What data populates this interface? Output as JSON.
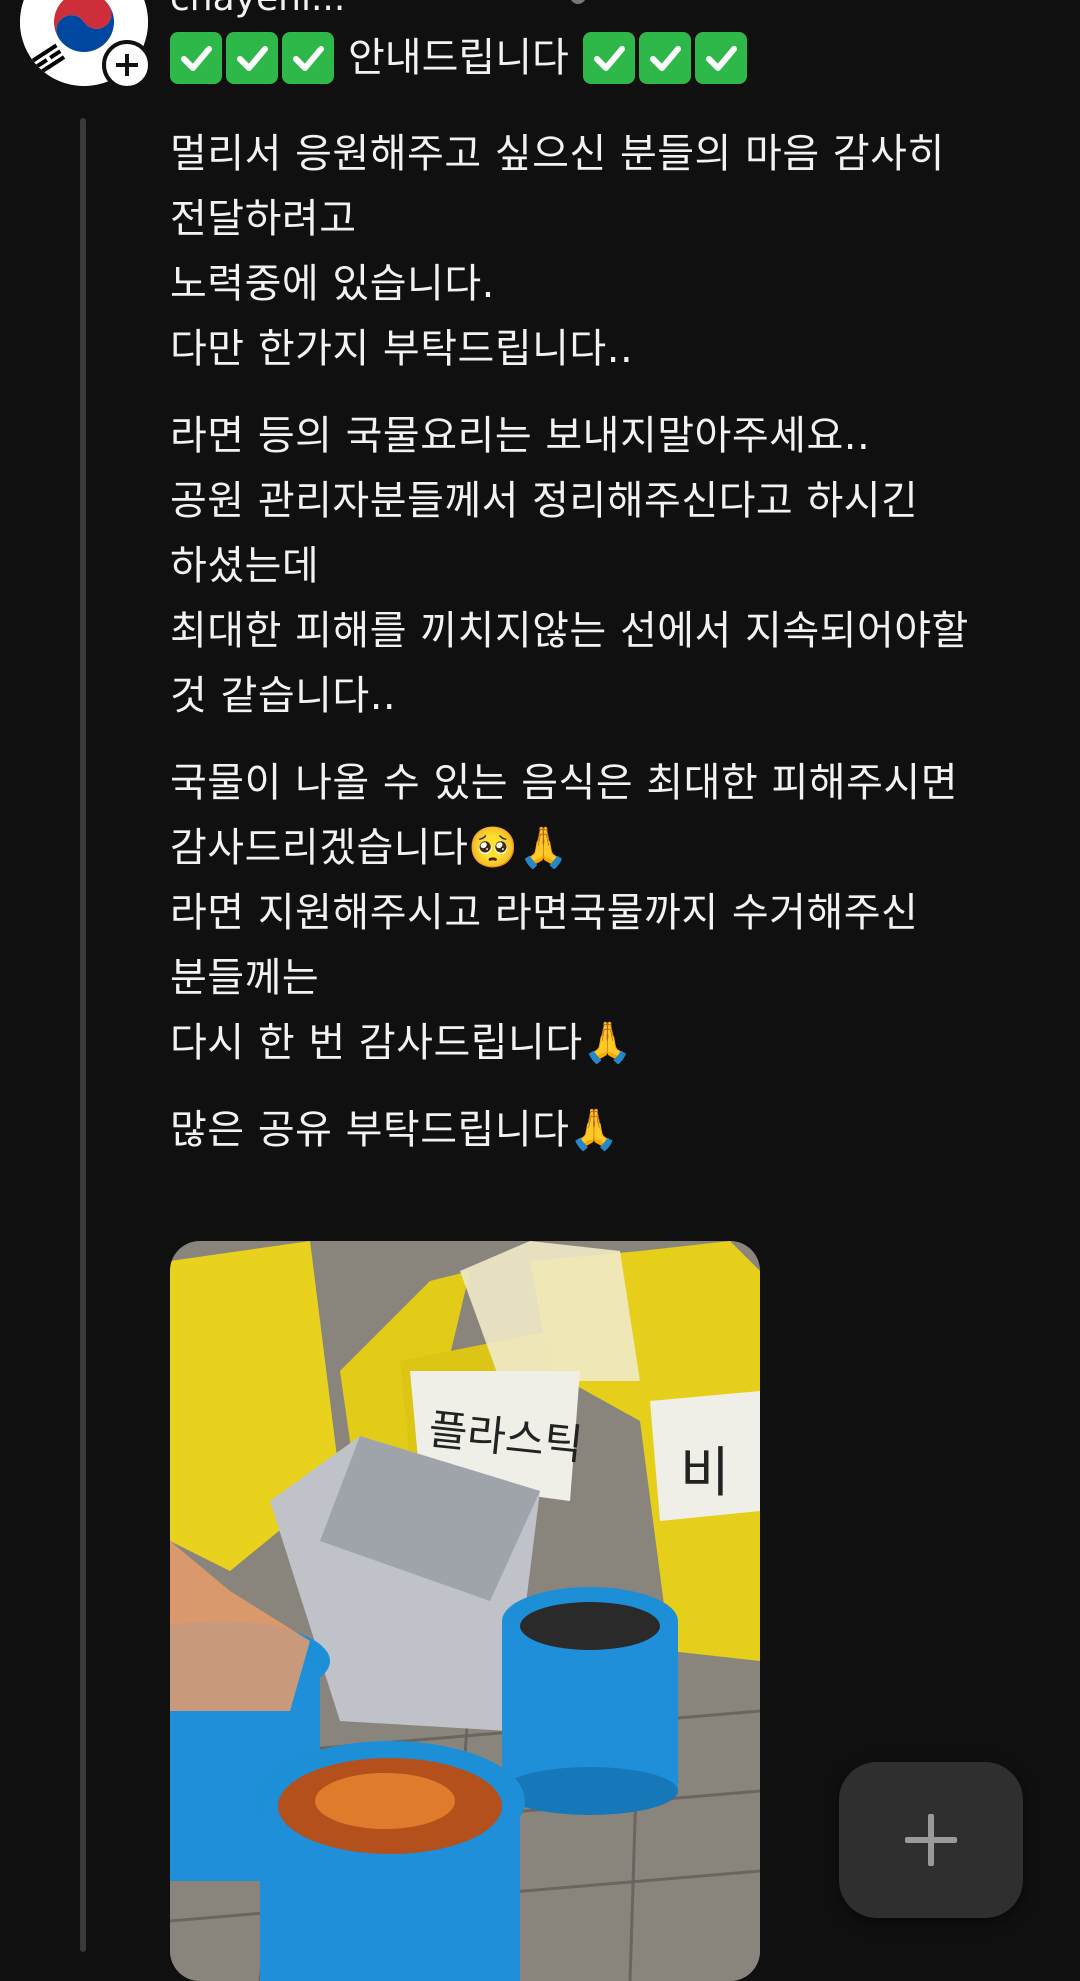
{
  "post": {
    "author": {
      "username": "chayeni...",
      "avatar_icon": "korean-flag-icon",
      "follow_icon": "plus-icon"
    },
    "headline": {
      "prefix_icons": [
        "check-mark-button-icon",
        "check-mark-button-icon",
        "check-mark-button-icon"
      ],
      "text": "안내드립니다",
      "suffix_icons": [
        "check-mark-button-icon",
        "check-mark-button-icon",
        "check-mark-button-icon"
      ]
    },
    "paragraphs": [
      {
        "lines": [
          "멀리서 응원해주고 싶으신 분들의 마음 감사히",
          "전달하려고",
          "노력중에 있습니다.",
          "다만 한가지 부탁드립니다.."
        ]
      },
      {
        "lines": [
          "라면 등의 국물요리는 보내지말아주세요..",
          "공원 관리자분들께서 정리해주신다고 하시긴",
          "하셨는데",
          "최대한 피해를 끼치지않는 선에서 지속되어야할",
          "것 같습니다.."
        ]
      },
      {
        "lines": [
          "국물이 나올 수 있는 음식은 최대한 피해주시면",
          "감사드리겠습니다🥺🙏",
          "라면 지원해주시고 라면국물까지 수거해주신",
          "분들께는",
          "다시 한 번 감사드립니다🙏"
        ]
      },
      {
        "lines": [
          "많은 공유 부탁드립니다🙏"
        ]
      }
    ],
    "photo": {
      "sign_plastic": "플라스틱",
      "sign_partial": "비"
    }
  },
  "fab": {
    "icon": "plus-icon"
  },
  "colors": {
    "background": "#101010",
    "text": "#f2f2f2",
    "check_green": "#2fb84a",
    "thread_line": "#3a3a3a",
    "fab_bg": "#2f2f2f"
  }
}
